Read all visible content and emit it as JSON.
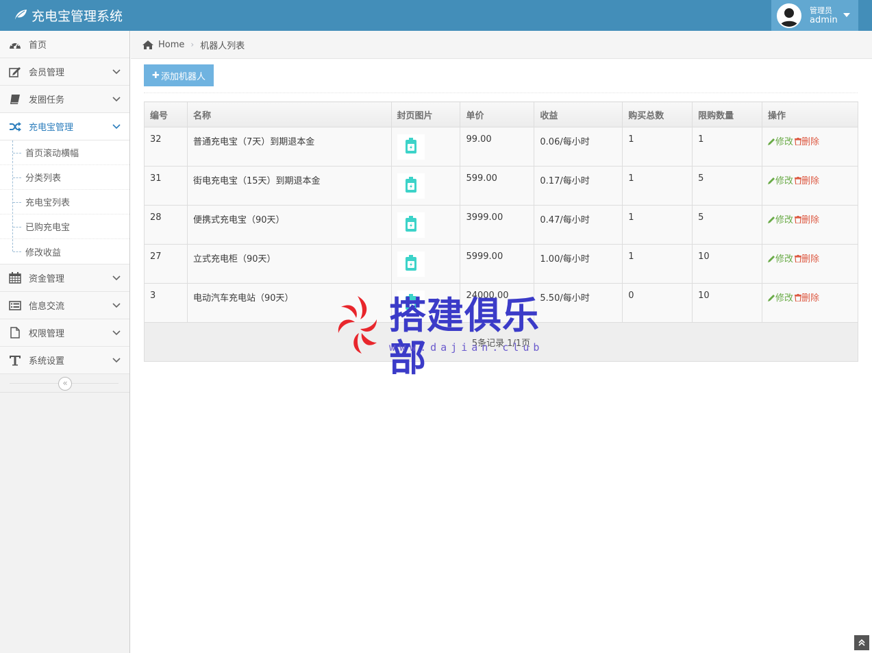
{
  "app": {
    "title": "充电宝管理系统"
  },
  "user": {
    "role": "管理员",
    "name": "admin"
  },
  "sidebar": {
    "items": [
      {
        "label": "首页",
        "icon": "dashboard-icon"
      },
      {
        "label": "会员管理",
        "icon": "edit-icon"
      },
      {
        "label": "发圈任务",
        "icon": "book-icon"
      },
      {
        "label": "充电宝管理",
        "icon": "random-icon"
      },
      {
        "label": "资金管理",
        "icon": "calendar-icon"
      },
      {
        "label": "信息交流",
        "icon": "list-icon"
      },
      {
        "label": "权限管理",
        "icon": "file-icon"
      },
      {
        "label": "系统设置",
        "icon": "text-icon"
      }
    ],
    "submenu": [
      "首页滚动横幅",
      "分类列表",
      "充电宝列表",
      "已购充电宝",
      "修改收益"
    ]
  },
  "breadcrumb": {
    "home": "Home",
    "current": "机器人列表"
  },
  "toolbar": {
    "add_label": "添加机器人"
  },
  "table": {
    "headers": [
      "编号",
      "名称",
      "封页图片",
      "单价",
      "收益",
      "购买总数",
      "限购数量",
      "操作"
    ],
    "rows": [
      {
        "id": "32",
        "name": "普通充电宝（7天）到期退本金",
        "price": "99.00",
        "income": "0.06/每小时",
        "total": "1",
        "limit": "1"
      },
      {
        "id": "31",
        "name": "街电充电宝（15天）到期退本金",
        "price": "599.00",
        "income": "0.17/每小时",
        "total": "1",
        "limit": "5"
      },
      {
        "id": "28",
        "name": "便携式充电宝（90天）",
        "price": "3999.00",
        "income": "0.47/每小时",
        "total": "1",
        "limit": "5"
      },
      {
        "id": "27",
        "name": "立式充电柜（90天）",
        "price": "5999.00",
        "income": "1.00/每小时",
        "total": "1",
        "limit": "10"
      },
      {
        "id": "3",
        "name": "电动汽车充电站（90天）",
        "price": "24000.00",
        "income": "5.50/每小时",
        "total": "0",
        "limit": "10"
      }
    ],
    "edit_label": "修改",
    "delete_label": "删除",
    "footer": "5条记录 1/1页"
  },
  "watermark": {
    "title": "搭建俱乐部",
    "url": "www.dajian.club"
  },
  "colors": {
    "navbar": "#438eb9",
    "accent": "#2b7dbc",
    "edit": "#69aa46",
    "delete": "#dd5a43",
    "button": "#6fb3e0",
    "cover_icon": "#3dd3c9"
  }
}
